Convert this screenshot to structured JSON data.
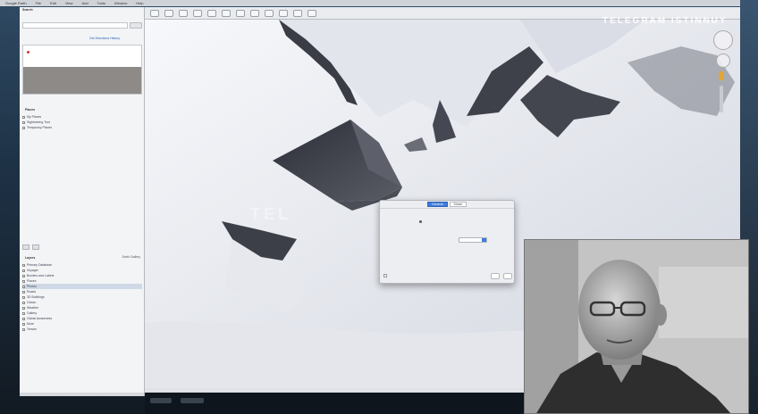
{
  "menubar": {
    "items": [
      "Google Earth",
      "File",
      "Edit",
      "View",
      "Add",
      "Tools",
      "Window",
      "Help"
    ]
  },
  "channel_watermark": "TELEGRAM ISTINNUY",
  "map_watermark": "TEL",
  "sidebar": {
    "search_title": "Search",
    "search_placeholder": "",
    "search_links": "Get Directions   History",
    "search_result": "",
    "places_title": "Places",
    "places": [
      {
        "label": "My Places",
        "selected": false
      },
      {
        "label": "Sightseeing Tour",
        "selected": false
      },
      {
        "label": "Temporary Places",
        "selected": false
      }
    ],
    "layers_title": "Layers",
    "layers_right": "Earth Gallery",
    "layers": [
      {
        "label": "Primary Database",
        "selected": false
      },
      {
        "label": "Voyager",
        "selected": false
      },
      {
        "label": "Borders and Labels",
        "selected": false
      },
      {
        "label": "Places",
        "selected": false
      },
      {
        "label": "Photos",
        "selected": true
      },
      {
        "label": "Roads",
        "selected": false
      },
      {
        "label": "3D Buildings",
        "selected": false
      },
      {
        "label": "Ocean",
        "selected": false
      },
      {
        "label": "Weather",
        "selected": false
      },
      {
        "label": "Gallery",
        "selected": false
      },
      {
        "label": "Global Awareness",
        "selected": false
      },
      {
        "label": "More",
        "selected": false
      },
      {
        "label": "Terrain",
        "selected": false
      }
    ]
  },
  "dialog": {
    "tabs": [
      "General",
      "Share"
    ],
    "active_tab": 0,
    "message": "",
    "rows": [
      {
        "label": "",
        "value": "",
        "select": ""
      },
      {
        "label": "",
        "value": "",
        "select": ""
      },
      {
        "label": "",
        "value": "",
        "select": ""
      }
    ],
    "footer_checkbox": "",
    "cancel_label": "",
    "ok_label": ""
  },
  "map": {
    "attribution": ""
  },
  "colors": {
    "snow": "#eceef3",
    "rock": "#3d3f4a",
    "dialog_accent": "#3b7ddd"
  }
}
